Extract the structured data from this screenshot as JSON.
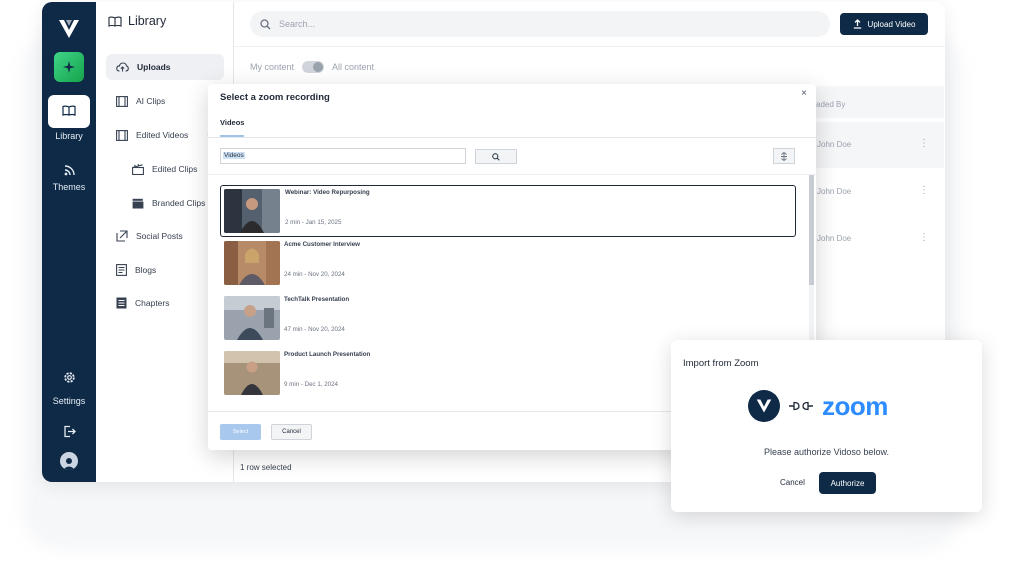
{
  "rail": {
    "items": [
      {
        "label": "Library",
        "icon": "book-icon"
      },
      {
        "label": "Themes",
        "icon": "rss-icon"
      },
      {
        "label": "Settings",
        "icon": "gear-icon"
      }
    ]
  },
  "library": {
    "title": "Library",
    "nav": [
      {
        "label": "Uploads"
      },
      {
        "label": "AI Clips"
      },
      {
        "label": "Edited Videos"
      },
      {
        "label": "Edited Clips"
      },
      {
        "label": "Branded Clips"
      },
      {
        "label": "Social Posts"
      },
      {
        "label": "Blogs"
      },
      {
        "label": "Chapters"
      }
    ]
  },
  "main": {
    "search_placeholder": "Search...",
    "upload_label": "Upload Video",
    "toggle_left": "My content",
    "toggle_right": "All content",
    "column_header": "aded By",
    "rows": [
      "John Doe",
      "John Doe",
      "John Doe"
    ],
    "row_selected": "1 row selected"
  },
  "zoom_dialog": {
    "title": "Select a zoom recording",
    "close": "×",
    "tab": "Videos",
    "filter_value": "Videos",
    "videos": [
      {
        "name": "Webinar: Video Repurposing",
        "meta": "2 min - Jan 15, 2025"
      },
      {
        "name": "Acme Customer Interview",
        "meta": "24 min - Nov 20, 2024"
      },
      {
        "name": "TechTalk Presentation",
        "meta": "47 min - Nov 20, 2024"
      },
      {
        "name": "Product Launch Presentation",
        "meta": "9 min - Dec 1, 2024"
      }
    ],
    "select_label": "Select",
    "cancel_label": "Cancel"
  },
  "import_card": {
    "title": "Import from Zoom",
    "zoom_logo": "zoom",
    "message": "Please authorize Vidoso below.",
    "cancel_label": "Cancel",
    "authorize_label": "Authorize"
  },
  "colors": {
    "navy": "#0e2a47",
    "zoom_blue": "#2d8cff",
    "select_disabled": "#a9c8ee"
  }
}
